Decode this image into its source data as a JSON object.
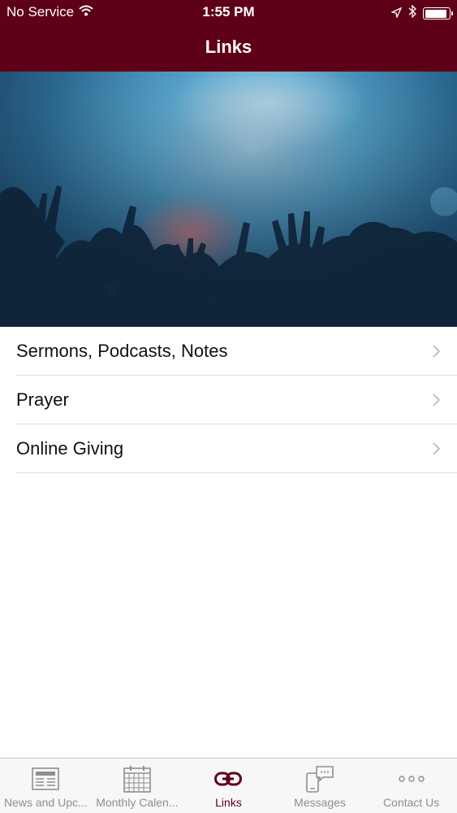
{
  "status_bar": {
    "carrier": "No Service",
    "time": "1:55 PM",
    "battery_level": 0.9
  },
  "nav": {
    "title": "Links"
  },
  "hero": {
    "icon": "worship-crowd-photo"
  },
  "links": [
    {
      "label": "Sermons, Podcasts, Notes",
      "icon": "chevron-right-icon"
    },
    {
      "label": "Prayer",
      "icon": "chevron-right-icon"
    },
    {
      "label": "Online Giving",
      "icon": "chevron-right-icon"
    }
  ],
  "tabs": [
    {
      "label": "News and Upc...",
      "icon": "newspaper-icon",
      "active": false
    },
    {
      "label": "Monthly Calen...",
      "icon": "calendar-icon",
      "active": false
    },
    {
      "label": "Links",
      "icon": "link-icon",
      "active": true
    },
    {
      "label": "Messages",
      "icon": "phone-chat-icon",
      "active": false
    },
    {
      "label": "Contact Us",
      "icon": "more-icon",
      "active": false
    }
  ],
  "colors": {
    "brand": "#5e0017",
    "tab_inactive": "#8e8e93",
    "separator": "#dcdcdc"
  }
}
